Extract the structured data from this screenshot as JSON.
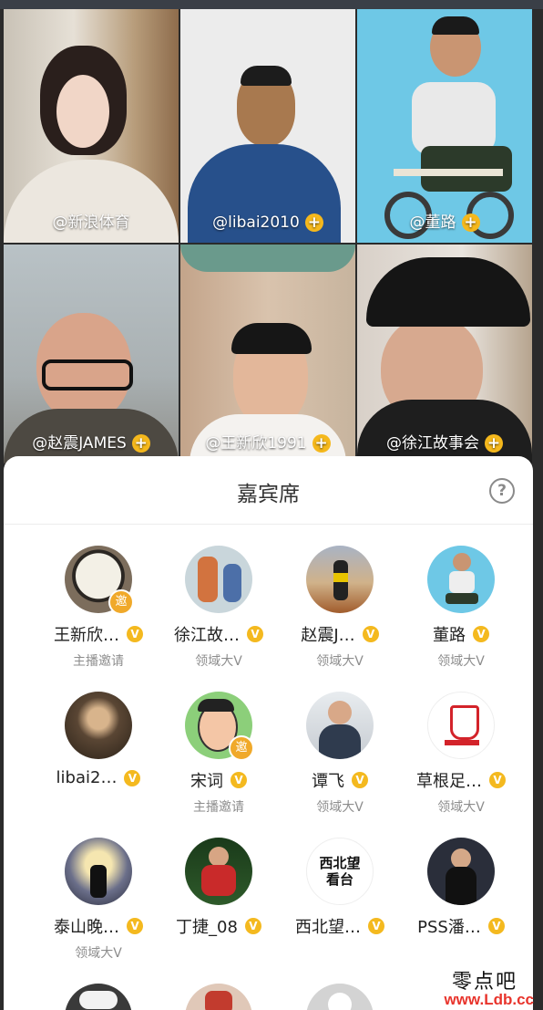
{
  "grid": {
    "tiles": [
      {
        "label": "@新浪体育",
        "follow": false
      },
      {
        "label": "@libai2010",
        "follow": true
      },
      {
        "label": "@董路",
        "follow": true
      },
      {
        "label": "@赵震JAMES",
        "follow": true
      },
      {
        "label": "@王新欣1991",
        "follow": true
      },
      {
        "label": "@徐江故事会",
        "follow": true
      }
    ],
    "follow_symbol": "+"
  },
  "panel": {
    "title": "嘉宾席",
    "help_symbol": "?",
    "invite_badge": "邀",
    "v_badge": "V",
    "guests": [
      {
        "name": "王新欣…",
        "role": "主播邀请",
        "invited": true
      },
      {
        "name": "徐江故…",
        "role": "领域大V",
        "invited": false
      },
      {
        "name": "赵震J…",
        "role": "领域大V",
        "invited": false
      },
      {
        "name": "董路",
        "role": "领域大V",
        "invited": false
      },
      {
        "name": "libai2…",
        "role": "",
        "invited": false
      },
      {
        "name": "宋词",
        "role": "主播邀请",
        "invited": true
      },
      {
        "name": "谭飞",
        "role": "领域大V",
        "invited": false
      },
      {
        "name": "草根足…",
        "role": "领域大V",
        "invited": false
      },
      {
        "name": "泰山晚…",
        "role": "领域大V",
        "invited": false
      },
      {
        "name": "丁捷_08",
        "role": "",
        "invited": false
      },
      {
        "name": "西北望…",
        "role": "",
        "invited": false
      },
      {
        "name": "PSS潘…",
        "role": "",
        "invited": false
      }
    ],
    "logo_text_westnorth": "西北望看台"
  },
  "watermark": {
    "line1": "零点吧",
    "line2": "www.Ldb.cc"
  }
}
